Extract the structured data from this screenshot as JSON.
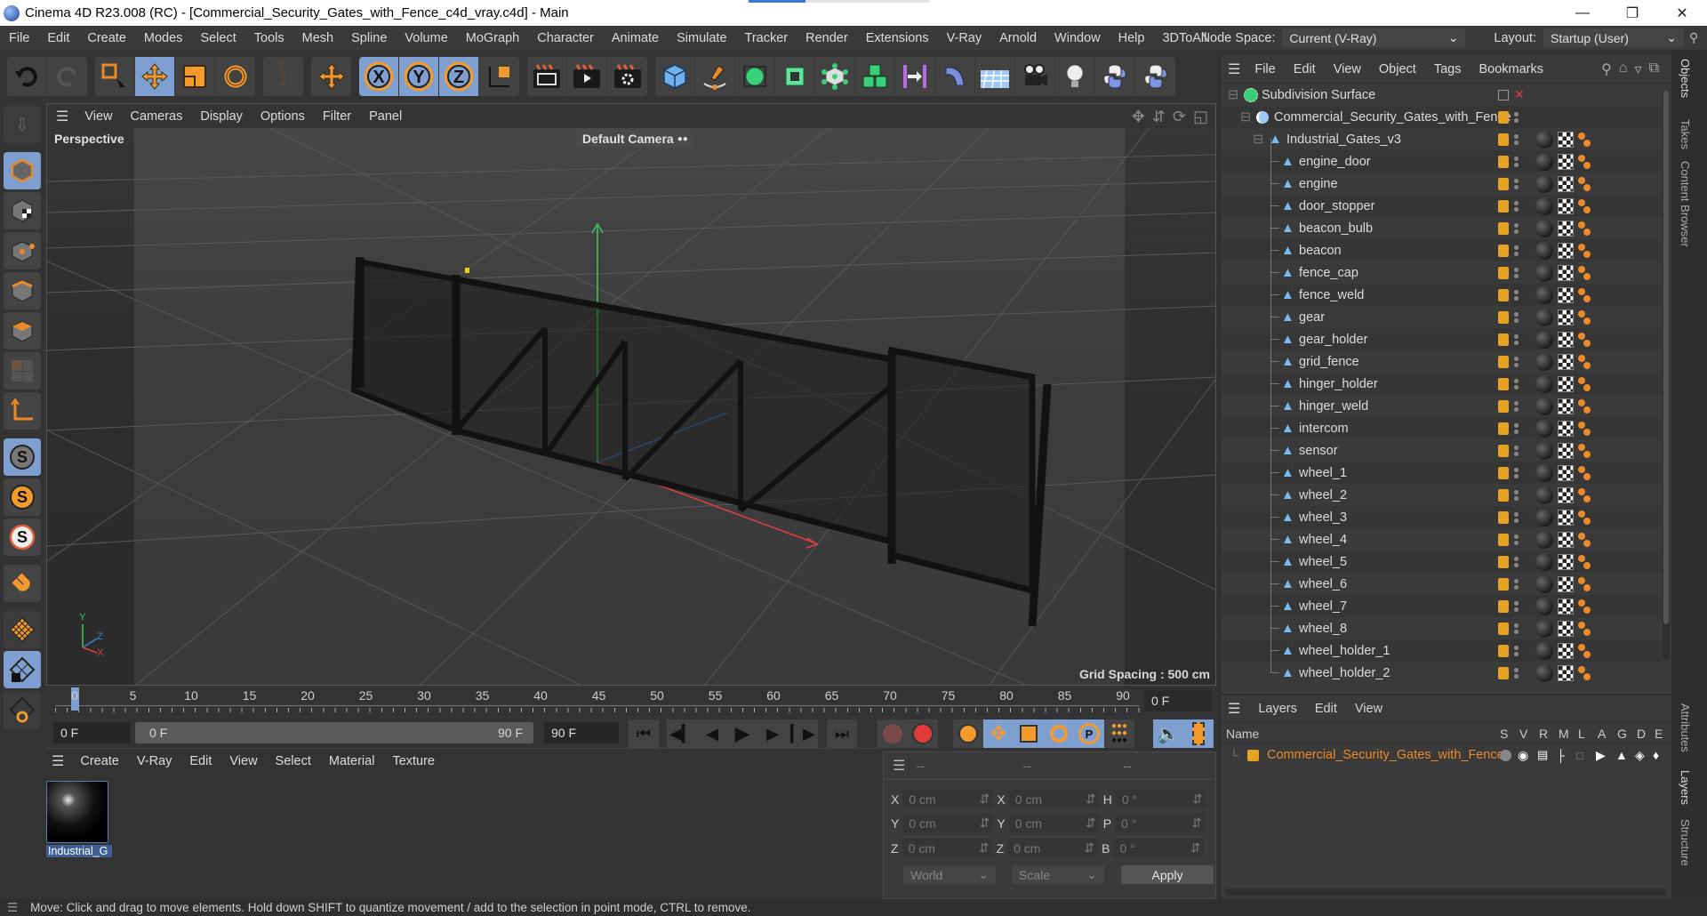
{
  "window": {
    "title": "Cinema 4D R23.008 (RC) - [Commercial_Security_Gates_with_Fence_c4d_vray.c4d] - Main",
    "controls": [
      "minimize",
      "restore",
      "close"
    ]
  },
  "menubar": {
    "items": [
      "File",
      "Edit",
      "Create",
      "Modes",
      "Select",
      "Tools",
      "Mesh",
      "Spline",
      "Volume",
      "MoGraph",
      "Character",
      "Animate",
      "Simulate",
      "Tracker",
      "Render",
      "Extensions",
      "V-Ray",
      "Arnold",
      "Window",
      "Help",
      "3DToAll"
    ],
    "node_space_label": "Node Space:",
    "node_space_value": "Current (V-Ray)",
    "layout_label": "Layout:",
    "layout_value": "Startup (User)"
  },
  "toolbar": {
    "groups": [
      [
        "undo-icon",
        "redo-icon"
      ],
      [
        "live-selection-icon",
        "move-icon",
        "scale-icon",
        "rotate-icon"
      ],
      [
        "psr-icon"
      ],
      [
        "coordinate-system-icon"
      ],
      [
        "x-axis-lock-icon",
        "y-axis-lock-icon",
        "z-axis-lock-icon",
        "world-coordinates-icon"
      ],
      [
        "render-view-icon",
        "render-picture-viewer-icon",
        "render-settings-icon"
      ],
      [
        "cube-icon",
        "pen-icon",
        "subdivision-surface-icon",
        "extrude-icon",
        "array-icon",
        "cloner-icon",
        "symmetry-icon",
        "deformer-bend-icon",
        "floor-icon",
        "camera-icon",
        "light-icon",
        "python-icon",
        "python-generator-icon"
      ]
    ],
    "active": [
      "move-icon",
      "x-axis-lock-icon",
      "y-axis-lock-icon",
      "z-axis-lock-icon"
    ]
  },
  "leftbar": {
    "tools": [
      "make-editable-icon",
      "model-mode-icon",
      "texture-mode-icon",
      "point-mode-icon",
      "edge-mode-icon",
      "polygon-mode-icon",
      "uv-mode-icon",
      "axis-mode-icon",
      "snap-icon",
      "snap-settings-icon",
      "snap-enable-icon",
      "magnet-icon",
      "workplane-icon",
      "locked-workplane-icon",
      "planar-workplane-icon"
    ]
  },
  "viewport": {
    "menu": [
      "View",
      "Cameras",
      "Display",
      "Options",
      "Filter",
      "Panel"
    ],
    "view_name": "Perspective",
    "camera_name": "Default Camera",
    "grid_spacing": "Grid Spacing : 500 cm",
    "axis_labels": {
      "y": "Y",
      "z": "Z",
      "x": "X"
    }
  },
  "timeline": {
    "ticks": [
      "0",
      "5",
      "10",
      "15",
      "20",
      "25",
      "30",
      "35",
      "40",
      "45",
      "50",
      "55",
      "60",
      "65",
      "70",
      "75",
      "80",
      "85",
      "90"
    ],
    "current_frame": "0 F",
    "start_frame": "0 F",
    "range_start": "0 F",
    "range_end": "90 F",
    "end_frame": "90 F",
    "current_frame_right": "0 F"
  },
  "material_manager": {
    "menu": [
      "Create",
      "V-Ray",
      "Edit",
      "View",
      "Select",
      "Material",
      "Texture"
    ],
    "materials": [
      {
        "name": "Industrial_G"
      }
    ]
  },
  "coordinates": {
    "headers": [
      "--",
      "--",
      "--"
    ],
    "position": [
      {
        "axis": "X",
        "value": "0 cm"
      },
      {
        "axis": "Y",
        "value": "0 cm"
      },
      {
        "axis": "Z",
        "value": "0 cm"
      }
    ],
    "size": [
      {
        "axis": "X",
        "value": "0 cm"
      },
      {
        "axis": "Y",
        "value": "0 cm"
      },
      {
        "axis": "Z",
        "value": "0 cm"
      }
    ],
    "rotation": [
      {
        "axis": "H",
        "value": "0 °"
      },
      {
        "axis": "P",
        "value": "0 °"
      },
      {
        "axis": "B",
        "value": "0 °"
      }
    ],
    "mode_select": "World",
    "size_select": "Scale",
    "apply_label": "Apply"
  },
  "object_manager": {
    "menu": [
      "File",
      "Edit",
      "View",
      "Object",
      "Tags",
      "Bookmarks"
    ],
    "root": "Subdivision Surface",
    "group": "Commercial_Security_Gates_with_Fence",
    "subgroup": "Industrial_Gates_v3",
    "children": [
      "engine_door",
      "engine",
      "door_stopper",
      "beacon_bulb",
      "beacon",
      "fence_cap",
      "fence_weld",
      "gear",
      "gear_holder",
      "grid_fence",
      "hinger_holder",
      "hinger_weld",
      "intercom",
      "sensor",
      "wheel_1",
      "wheel_2",
      "wheel_3",
      "wheel_4",
      "wheel_5",
      "wheel_6",
      "wheel_7",
      "wheel_8",
      "wheel_holder_1",
      "wheel_holder_2"
    ]
  },
  "layer_manager": {
    "menu": [
      "Layers",
      "Edit",
      "View"
    ],
    "columns": [
      "Name",
      "S",
      "V",
      "R",
      "M",
      "L",
      "A",
      "G",
      "D",
      "E"
    ],
    "layers": [
      {
        "name": "Commercial_Security_Gates_with_Fence",
        "color": "#e6a223"
      }
    ]
  },
  "side_tabs": [
    "Objects",
    "Takes",
    "Content Browser",
    "Attributes",
    "Layers",
    "Structure"
  ],
  "status_bar": {
    "text": "Move: Click and drag to move elements. Hold down SHIFT to quantize movement / add to the selection in point mode, CTRL to remove."
  },
  "colors": {
    "accent_blue": "#7e9fcf",
    "accent_orange": "#e98a2b",
    "layer_orange": "#e6a223",
    "axis_x": "#e04040",
    "axis_y": "#3ec45a",
    "axis_z": "#3d7fd6"
  }
}
